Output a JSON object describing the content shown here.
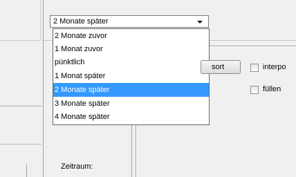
{
  "combo": {
    "selected": "2 Monate später"
  },
  "dropdown": {
    "options": [
      "2 Monate zuvor",
      "1 Monat zuvor",
      "pünktlich",
      "1 Monat später",
      "2 Monate später",
      "3 Monate später",
      "4 Monate später"
    ],
    "selected_index": 4
  },
  "controls": {
    "sort_label": "sort",
    "interpolate_label": "interpo",
    "fill_label": "füllen"
  },
  "labels": {
    "zeitraum": "Zeitraum:"
  },
  "colors": {
    "selection": "#3399ff",
    "window_bg": "#f0f0f0"
  }
}
